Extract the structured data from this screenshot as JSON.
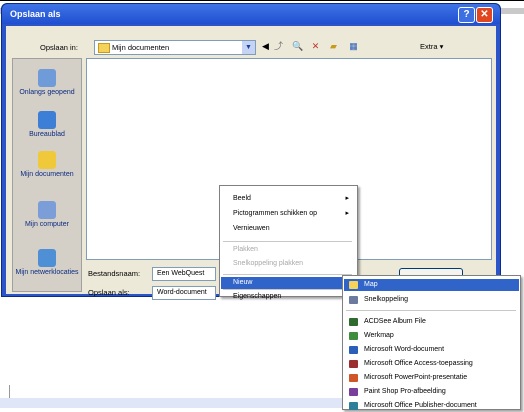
{
  "window": {
    "title": "Opslaan als"
  },
  "toolbar": {
    "save_in_label": "Opslaan in:",
    "location": "Mijn documenten",
    "extra_label": "Extra"
  },
  "places": [
    {
      "label": "Onlangs geopend",
      "icon": "recent-icon",
      "color": "#6f9bd8"
    },
    {
      "label": "Bureaublad",
      "icon": "desktop-icon",
      "color": "#3d7fd6"
    },
    {
      "label": "Mijn documenten",
      "icon": "documents-folder-icon",
      "color": "#f0c93a"
    },
    {
      "label": "Mijn computer",
      "icon": "computer-icon",
      "color": "#7b9ed9"
    },
    {
      "label": "Mijn netwerklocaties",
      "icon": "network-icon",
      "color": "#4f8fd6"
    }
  ],
  "filename": {
    "label": "Bestandsnaam:",
    "value": "Een WebQuest"
  },
  "filetype": {
    "label": "Opslaan als:",
    "value": "Word-document"
  },
  "context_menu": {
    "items": [
      {
        "label": "Beeld",
        "submenu": "▸",
        "disabled": false
      },
      {
        "label": "Pictogrammen schikken op",
        "submenu": "▸",
        "disabled": false
      },
      {
        "label": "Vernieuwen",
        "disabled": false
      },
      {
        "label": "Plakken",
        "disabled": true
      },
      {
        "label": "Snelkoppeling plakken",
        "disabled": true
      },
      {
        "label": "Nieuw",
        "submenu": "▸",
        "disabled": false,
        "highlighted": true
      },
      {
        "label": "Eigenschappen",
        "disabled": false
      }
    ]
  },
  "new_submenu": {
    "items": [
      {
        "label": "Map",
        "icon": "folder-icon",
        "color": "#f5d35b",
        "highlighted": true
      },
      {
        "label": "Snelkoppeling",
        "icon": "shortcut-icon",
        "color": "#6c7aa0"
      },
      {
        "label": "ACDSee Album File",
        "icon": "acdsee-icon",
        "color": "#2f6b2f"
      },
      {
        "label": "Werkmap",
        "icon": "excel-icon",
        "color": "#3e8e3e"
      },
      {
        "label": "Microsoft Word-document",
        "icon": "word-icon",
        "color": "#2b5fb8"
      },
      {
        "label": "Microsoft Office Access-toepassing",
        "icon": "access-icon",
        "color": "#9b2f2f"
      },
      {
        "label": "Microsoft PowerPoint-presentatie",
        "icon": "powerpoint-icon",
        "color": "#d0562a"
      },
      {
        "label": "Paint Shop Pro-afbeelding",
        "icon": "paintshop-icon",
        "color": "#7a3f9b"
      },
      {
        "label": "Microsoft Office Publisher-document",
        "icon": "publisher-icon",
        "color": "#2f7f9b"
      }
    ]
  }
}
